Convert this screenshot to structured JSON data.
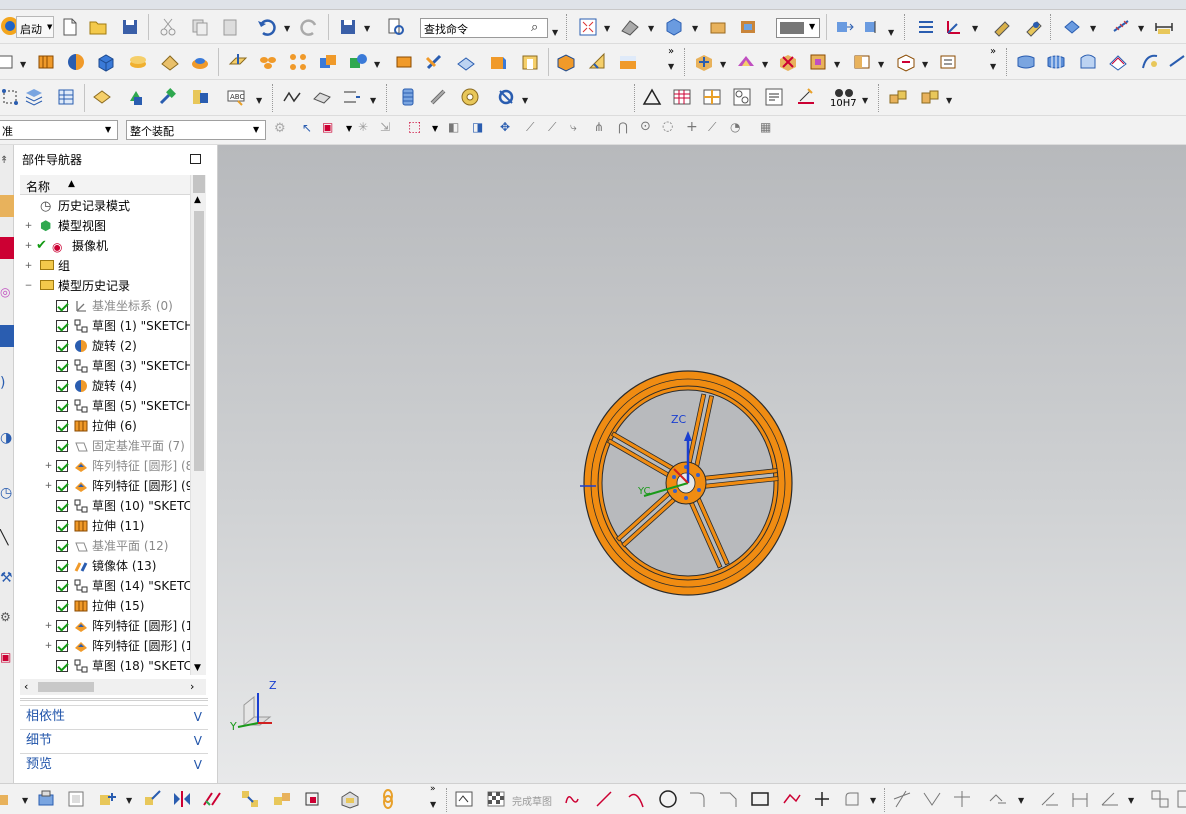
{
  "toolbar": {
    "start_label": "启动",
    "search_placeholder": "查找命令",
    "tolerance_label": "10H7",
    "filter_left_value": "准",
    "assembly_filter_value": "整个装配"
  },
  "bottom_toolbar": {
    "finish_sketch_label": "完成草图"
  },
  "navigator": {
    "title": "部件导航器",
    "column_name": "名称",
    "top_nodes": [
      {
        "label": "历史记录模式"
      },
      {
        "label": "模型视图"
      },
      {
        "label": "摄像机"
      },
      {
        "label": "组"
      },
      {
        "label": "模型历史记录"
      }
    ],
    "features": [
      {
        "label": "基准坐标系 (0)",
        "dim": true
      },
      {
        "label": "草图 (1) \"SKETCH",
        "dim": false
      },
      {
        "label": "旋转 (2)",
        "dim": false
      },
      {
        "label": "草图 (3) \"SKETCH",
        "dim": false
      },
      {
        "label": "旋转 (4)",
        "dim": false
      },
      {
        "label": "草图 (5) \"SKETCH",
        "dim": false
      },
      {
        "label": "拉伸 (6)",
        "dim": false
      },
      {
        "label": "固定基准平面 (7)",
        "dim": true
      },
      {
        "label": "阵列特征 [圆形] (8",
        "dim": true
      },
      {
        "label": "阵列特征 [圆形] (9",
        "dim": false
      },
      {
        "label": "草图 (10) \"SKETC",
        "dim": false
      },
      {
        "label": "拉伸 (11)",
        "dim": false
      },
      {
        "label": "基准平面 (12)",
        "dim": true
      },
      {
        "label": "镜像体 (13)",
        "dim": false
      },
      {
        "label": "草图 (14) \"SKETC",
        "dim": false
      },
      {
        "label": "拉伸 (15)",
        "dim": false
      },
      {
        "label": "阵列特征 [圆形] (1",
        "dim": false
      },
      {
        "label": "阵列特征 [圆形] (1",
        "dim": false
      },
      {
        "label": "草图 (18) \"SKETC",
        "dim": false
      }
    ],
    "panels": [
      {
        "label": "相依性"
      },
      {
        "label": "细节"
      },
      {
        "label": "预览"
      }
    ]
  },
  "viewport": {
    "axis_label_zc": "ZC",
    "axis_label_yc": "YC",
    "triad_z": "Z",
    "triad_y": "Y",
    "model_color": "#f08c12"
  }
}
